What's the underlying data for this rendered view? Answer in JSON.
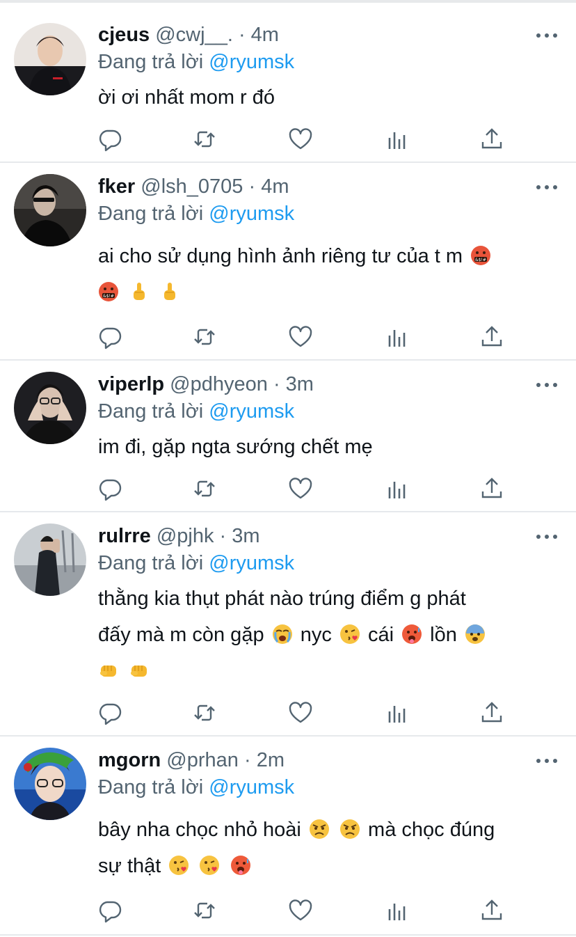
{
  "reply_prefix": "Đang trả lời",
  "tweets": [
    {
      "name": "cjeus",
      "handle": "@cwj__.",
      "time": "4m",
      "reply_to": "@ryumsk",
      "text_lines": [
        "ời ơi nhất mom r đó"
      ],
      "emojis": []
    },
    {
      "name": "fker",
      "handle": "@lsh_0705",
      "time": "4m",
      "reply_to": "@ryumsk",
      "text_lines": [
        "ai cho sử dụng hình ảnh riêng tư của t m"
      ],
      "emojis": [
        "face-with-symbols-on-mouth",
        "face-with-symbols-on-mouth",
        "middle-finger",
        "middle-finger"
      ]
    },
    {
      "name": "viperlp",
      "handle": "@pdhyeon",
      "time": "3m",
      "reply_to": "@ryumsk",
      "text_lines": [
        "im đi, gặp ngta sướng chết mẹ"
      ],
      "emojis": []
    },
    {
      "name": "rulrre",
      "handle": "@pjhk",
      "time": "3m",
      "reply_to": "@ryumsk",
      "text_lines": [
        "thằng kia thụt phát nào trúng điểm g phát",
        "đấy mà m còn gặp",
        "nyc",
        "cái",
        "lồn"
      ],
      "emojis": [
        "loudly-crying-face",
        "face-blowing-a-kiss",
        "hot-face",
        "fearful-face",
        "oncoming-fist",
        "oncoming-fist"
      ]
    },
    {
      "name": "mgorn",
      "handle": "@prhan",
      "time": "2m",
      "reply_to": "@ryumsk",
      "text_lines": [
        "bây nha chọc nhỏ hoài",
        "mà chọc đúng",
        "sự thật"
      ],
      "emojis": [
        "angry-face",
        "angry-face",
        "face-blowing-a-kiss",
        "face-blowing-a-kiss",
        "hot-face"
      ]
    }
  ],
  "action_icons": [
    "reply-icon",
    "retweet-icon",
    "like-icon",
    "analytics-icon",
    "share-icon"
  ],
  "colors": {
    "mention": "#1d9bf0",
    "secondary_text": "#536471",
    "divider": "#e6e9ec"
  }
}
